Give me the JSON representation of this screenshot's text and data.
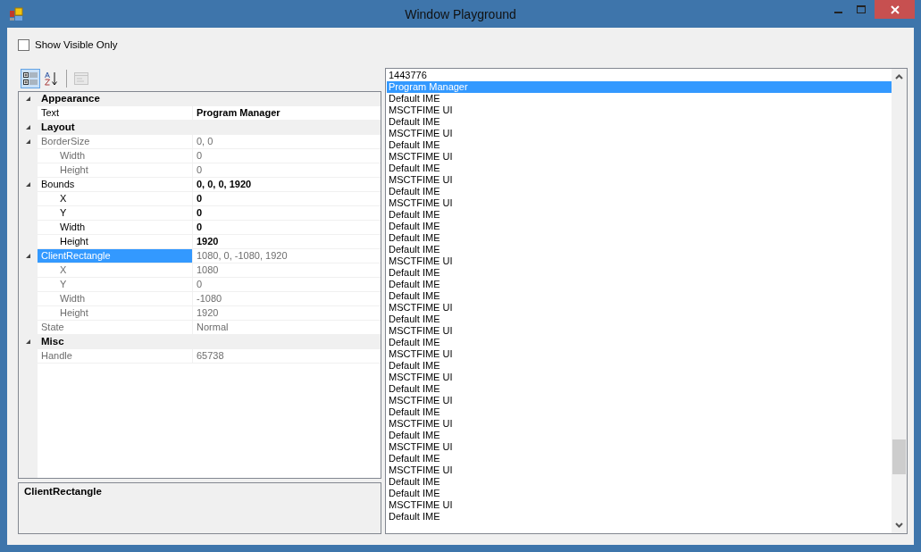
{
  "window": {
    "title": "Window Playground"
  },
  "show_visible_only": {
    "label": "Show Visible Only",
    "checked": false
  },
  "toolbar": [
    {
      "kind": "categorized",
      "selected": true
    },
    {
      "kind": "alphabetical",
      "selected": false
    },
    {
      "kind": "pages",
      "selected": false,
      "disabled": true
    }
  ],
  "property_grid": {
    "categories": [
      {
        "name": "Appearance",
        "expanded": true,
        "properties": [
          {
            "name": "Text",
            "value": "Program Manager",
            "bold": true,
            "readonly": false,
            "selected": false
          }
        ]
      },
      {
        "name": "Layout",
        "expanded": true,
        "properties": [
          {
            "name": "BorderSize",
            "value": "0, 0",
            "bold": false,
            "readonly": true,
            "selected": false,
            "expanded": true,
            "children": [
              {
                "name": "Width",
                "value": "0",
                "bold": false,
                "readonly": true,
                "selected": false
              },
              {
                "name": "Height",
                "value": "0",
                "bold": false,
                "readonly": true,
                "selected": false
              }
            ]
          },
          {
            "name": "Bounds",
            "value": "0, 0, 0, 1920",
            "bold": true,
            "readonly": false,
            "selected": false,
            "expanded": true,
            "children": [
              {
                "name": "X",
                "value": "0",
                "bold": true,
                "readonly": false,
                "selected": false
              },
              {
                "name": "Y",
                "value": "0",
                "bold": true,
                "readonly": false,
                "selected": false
              },
              {
                "name": "Width",
                "value": "0",
                "bold": true,
                "readonly": false,
                "selected": false
              },
              {
                "name": "Height",
                "value": "1920",
                "bold": true,
                "readonly": false,
                "selected": false
              }
            ]
          },
          {
            "name": "ClientRectangle",
            "value": "1080, 0, -1080, 1920",
            "bold": false,
            "readonly": true,
            "selected": true,
            "expanded": true,
            "children": [
              {
                "name": "X",
                "value": "1080",
                "bold": false,
                "readonly": true,
                "selected": false
              },
              {
                "name": "Y",
                "value": "0",
                "bold": false,
                "readonly": true,
                "selected": false
              },
              {
                "name": "Width",
                "value": "-1080",
                "bold": false,
                "readonly": true,
                "selected": false
              },
              {
                "name": "Height",
                "value": "1920",
                "bold": false,
                "readonly": true,
                "selected": false
              }
            ]
          },
          {
            "name": "State",
            "value": "Normal",
            "bold": false,
            "readonly": true,
            "selected": false
          }
        ]
      },
      {
        "name": "Misc",
        "expanded": true,
        "properties": [
          {
            "name": "Handle",
            "value": "65738",
            "bold": false,
            "readonly": true,
            "selected": false
          }
        ]
      }
    ],
    "description": {
      "title": "ClientRectangle"
    }
  },
  "window_list": [
    {
      "label": "1443776",
      "selected": false
    },
    {
      "label": "Program Manager",
      "selected": true
    },
    {
      "label": "Default IME",
      "selected": false
    },
    {
      "label": "MSCTFIME UI",
      "selected": false
    },
    {
      "label": "Default IME",
      "selected": false
    },
    {
      "label": "MSCTFIME UI",
      "selected": false
    },
    {
      "label": "Default IME",
      "selected": false
    },
    {
      "label": "MSCTFIME UI",
      "selected": false
    },
    {
      "label": "Default IME",
      "selected": false
    },
    {
      "label": "MSCTFIME UI",
      "selected": false
    },
    {
      "label": "Default IME",
      "selected": false
    },
    {
      "label": "MSCTFIME UI",
      "selected": false
    },
    {
      "label": "Default IME",
      "selected": false
    },
    {
      "label": "Default IME",
      "selected": false
    },
    {
      "label": "Default IME",
      "selected": false
    },
    {
      "label": "Default IME",
      "selected": false
    },
    {
      "label": "MSCTFIME UI",
      "selected": false
    },
    {
      "label": "Default IME",
      "selected": false
    },
    {
      "label": "Default IME",
      "selected": false
    },
    {
      "label": "Default IME",
      "selected": false
    },
    {
      "label": "MSCTFIME UI",
      "selected": false
    },
    {
      "label": "Default IME",
      "selected": false
    },
    {
      "label": "MSCTFIME UI",
      "selected": false
    },
    {
      "label": "Default IME",
      "selected": false
    },
    {
      "label": "MSCTFIME UI",
      "selected": false
    },
    {
      "label": "Default IME",
      "selected": false
    },
    {
      "label": "MSCTFIME UI",
      "selected": false
    },
    {
      "label": "Default IME",
      "selected": false
    },
    {
      "label": "MSCTFIME UI",
      "selected": false
    },
    {
      "label": "Default IME",
      "selected": false
    },
    {
      "label": "MSCTFIME UI",
      "selected": false
    },
    {
      "label": "Default IME",
      "selected": false
    },
    {
      "label": "MSCTFIME UI",
      "selected": false
    },
    {
      "label": "Default IME",
      "selected": false
    },
    {
      "label": "MSCTFIME UI",
      "selected": false
    },
    {
      "label": "Default IME",
      "selected": false
    },
    {
      "label": "Default IME",
      "selected": false
    },
    {
      "label": "MSCTFIME UI",
      "selected": false
    },
    {
      "label": "Default IME",
      "selected": false
    }
  ]
}
